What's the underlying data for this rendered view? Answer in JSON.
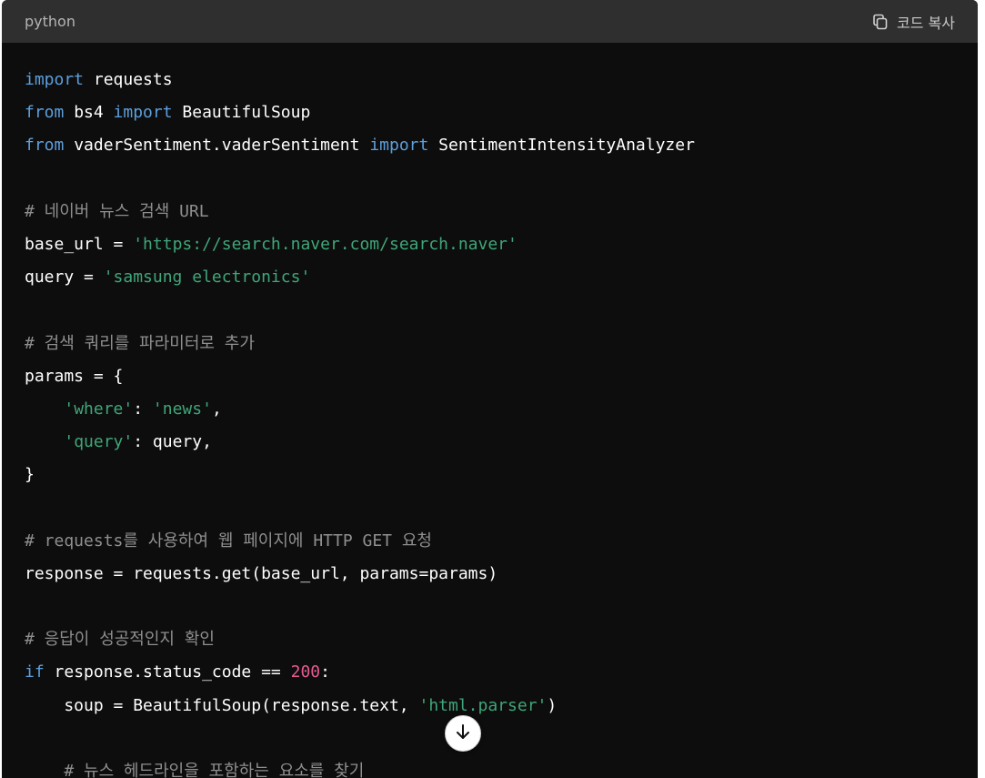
{
  "header": {
    "language": "python",
    "copy_label": "코드 복사"
  },
  "code_lines": [
    [
      {
        "t": "import",
        "c": "kw"
      },
      {
        "t": " requests",
        "c": ""
      }
    ],
    [
      {
        "t": "from",
        "c": "kw"
      },
      {
        "t": " bs4 ",
        "c": ""
      },
      {
        "t": "import",
        "c": "kw"
      },
      {
        "t": " BeautifulSoup",
        "c": ""
      }
    ],
    [
      {
        "t": "from",
        "c": "kw"
      },
      {
        "t": " vaderSentiment.vaderSentiment ",
        "c": ""
      },
      {
        "t": "import",
        "c": "kw"
      },
      {
        "t": " SentimentIntensityAnalyzer",
        "c": ""
      }
    ],
    [],
    [
      {
        "t": "# 네이버 뉴스 검색 URL",
        "c": "cm"
      }
    ],
    [
      {
        "t": "base_url = ",
        "c": ""
      },
      {
        "t": "'https://search.naver.com/search.naver'",
        "c": "str"
      }
    ],
    [
      {
        "t": "query = ",
        "c": ""
      },
      {
        "t": "'samsung electronics'",
        "c": "str"
      }
    ],
    [],
    [
      {
        "t": "# 검색 쿼리를 파라미터로 추가",
        "c": "cm"
      }
    ],
    [
      {
        "t": "params = {",
        "c": ""
      }
    ],
    [
      {
        "t": "    ",
        "c": ""
      },
      {
        "t": "'where'",
        "c": "str"
      },
      {
        "t": ": ",
        "c": ""
      },
      {
        "t": "'news'",
        "c": "str"
      },
      {
        "t": ",",
        "c": ""
      }
    ],
    [
      {
        "t": "    ",
        "c": ""
      },
      {
        "t": "'query'",
        "c": "str"
      },
      {
        "t": ": query,",
        "c": ""
      }
    ],
    [
      {
        "t": "}",
        "c": ""
      }
    ],
    [],
    [
      {
        "t": "# requests를 사용하여 웹 페이지에 HTTP GET 요청",
        "c": "cm"
      }
    ],
    [
      {
        "t": "response = requests.get(base_url, params=params)",
        "c": ""
      }
    ],
    [],
    [
      {
        "t": "# 응답이 성공적인지 확인",
        "c": "cm"
      }
    ],
    [
      {
        "t": "if",
        "c": "kw"
      },
      {
        "t": " response.status_code == ",
        "c": ""
      },
      {
        "t": "200",
        "c": "num"
      },
      {
        "t": ":",
        "c": ""
      }
    ],
    [
      {
        "t": "    soup = BeautifulSoup(response.text, ",
        "c": ""
      },
      {
        "t": "'html.parser'",
        "c": "str"
      },
      {
        "t": ")",
        "c": ""
      }
    ],
    [],
    [
      {
        "t": "    # 뉴스 헤드라인을 포함하는 요소를 찾기",
        "c": "cm"
      }
    ]
  ],
  "icons": {
    "copy": "copy-icon",
    "scroll_down": "arrow-down-icon"
  }
}
